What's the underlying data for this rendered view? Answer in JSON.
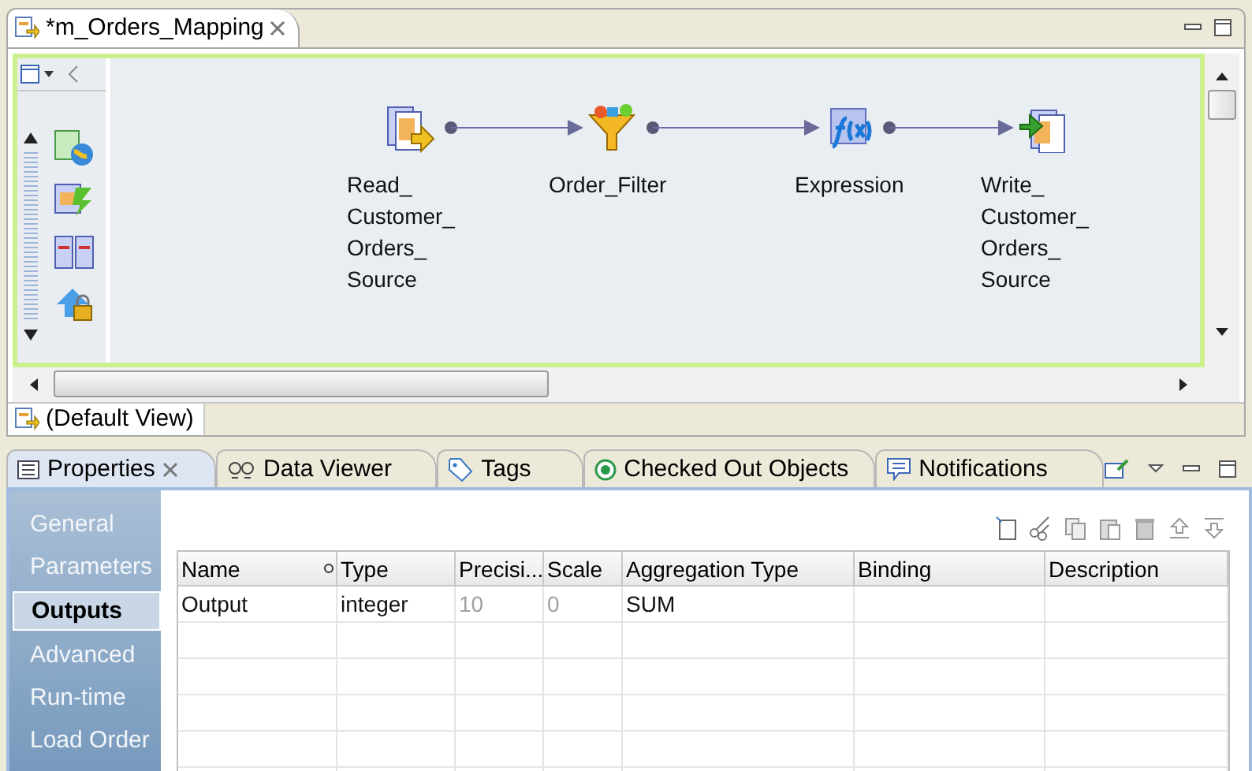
{
  "editor": {
    "tab": {
      "title": "*m_Orders_Mapping",
      "selected": true
    },
    "nodes": [
      {
        "kind": "read",
        "label_lines": [
          "Read_",
          "Customer_",
          "Orders_",
          "Source"
        ]
      },
      {
        "kind": "filter",
        "label_lines": [
          "Order_Filter"
        ]
      },
      {
        "kind": "expression",
        "label_lines": [
          "Expression"
        ]
      },
      {
        "kind": "write",
        "label_lines": [
          "Write_",
          "Customer_",
          "Orders_",
          "Source"
        ]
      }
    ],
    "view_tab": "(Default View)"
  },
  "panel": {
    "tabs": [
      {
        "label": "Properties",
        "selected": true
      },
      {
        "label": "Data Viewer",
        "selected": false
      },
      {
        "label": "Tags",
        "selected": false
      },
      {
        "label": "Checked Out Objects",
        "selected": false
      },
      {
        "label": "Notifications",
        "selected": false
      }
    ],
    "nav": [
      {
        "label": "General",
        "selected": false
      },
      {
        "label": "Parameters",
        "selected": false
      },
      {
        "label": "Outputs",
        "selected": true
      },
      {
        "label": "Advanced",
        "selected": false
      },
      {
        "label": "Run-time",
        "selected": false
      },
      {
        "label": "Load Order",
        "selected": false
      }
    ],
    "table": {
      "columns": [
        "Name",
        "Type",
        "Precisi...",
        "Scale",
        "Aggregation Type",
        "Binding",
        "Description"
      ],
      "rows": [
        {
          "cells": [
            {
              "text": "Output",
              "disabled": false
            },
            {
              "text": "integer",
              "disabled": false
            },
            {
              "text": "10",
              "disabled": true
            },
            {
              "text": "0",
              "disabled": true
            },
            {
              "text": "SUM",
              "disabled": false
            },
            {
              "text": "",
              "disabled": false
            },
            {
              "text": "",
              "disabled": false
            }
          ]
        }
      ]
    }
  }
}
